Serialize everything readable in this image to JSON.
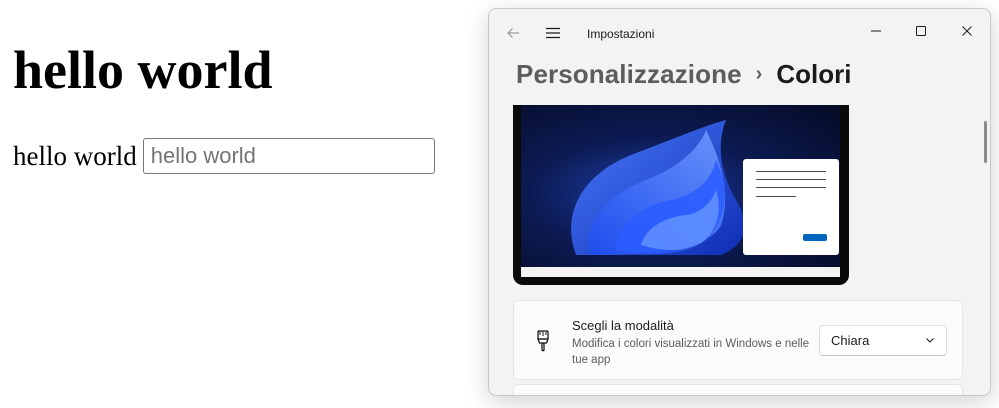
{
  "web": {
    "heading": "hello world",
    "label": "hello world",
    "input_placeholder": "hello world"
  },
  "settings": {
    "app_title": "Impostazioni",
    "breadcrumb": {
      "parent": "Personalizzazione",
      "separator": "›",
      "current": "Colori"
    },
    "mode_setting": {
      "title": "Scegli la modalità",
      "description": "Modifica i colori visualizzati in Windows e nelle tue app",
      "selected": "Chiara"
    },
    "colors": {
      "accent": "#0067c0",
      "window_bg": "#f3f3f3",
      "card_bg": "#fbfbfb"
    },
    "icons": {
      "back": "back-arrow-icon",
      "menu": "hamburger-menu-icon",
      "minimize": "minimize-icon",
      "maximize": "maximize-icon",
      "close": "close-icon",
      "mode": "paint-brush-icon",
      "dropdown": "chevron-down-icon"
    }
  }
}
